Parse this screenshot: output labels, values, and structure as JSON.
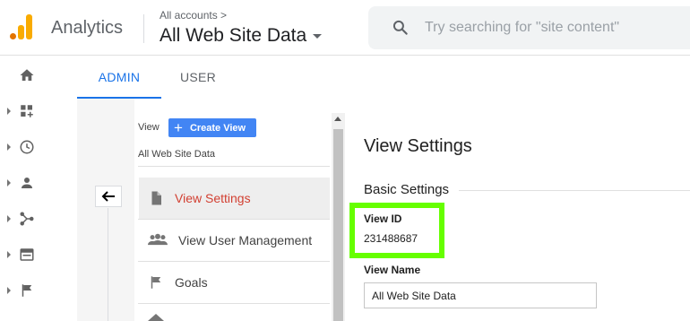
{
  "header": {
    "app_name": "Analytics",
    "account_breadcrumb": "All accounts >",
    "property_view": "All Web Site Data",
    "search_placeholder": "Try searching for \"site content\""
  },
  "colors": {
    "logo_orange": "#f9ab00",
    "logo_dark_orange": "#e37400",
    "accent_blue": "#1a73e8",
    "create_button": "#4285f4",
    "active_menu_text": "#d23f31",
    "highlight_box": "#66ff00"
  },
  "left_nav": [
    {
      "icon": "home-icon"
    },
    {
      "icon": "dashboard-icon"
    },
    {
      "icon": "clock-icon"
    },
    {
      "icon": "person-icon"
    },
    {
      "icon": "acquisition-icon"
    },
    {
      "icon": "browser-window-icon"
    },
    {
      "icon": "flag-icon"
    }
  ],
  "tabs": [
    {
      "label": "ADMIN",
      "active": true
    },
    {
      "label": "USER",
      "active": false
    }
  ],
  "view_column": {
    "label": "View",
    "create_button": "Create View",
    "selected_view": "All Web Site Data",
    "menu": [
      {
        "label": "View Settings",
        "icon": "document-icon",
        "active": true
      },
      {
        "label": "View User Management",
        "icon": "people-icon",
        "active": false
      },
      {
        "label": "Goals",
        "icon": "flag-icon",
        "active": false
      }
    ]
  },
  "settings": {
    "title": "View Settings",
    "section": "Basic Settings",
    "view_id_label": "View ID",
    "view_id_value": "231488687",
    "view_name_label": "View Name",
    "view_name_value": "All Web Site Data"
  }
}
